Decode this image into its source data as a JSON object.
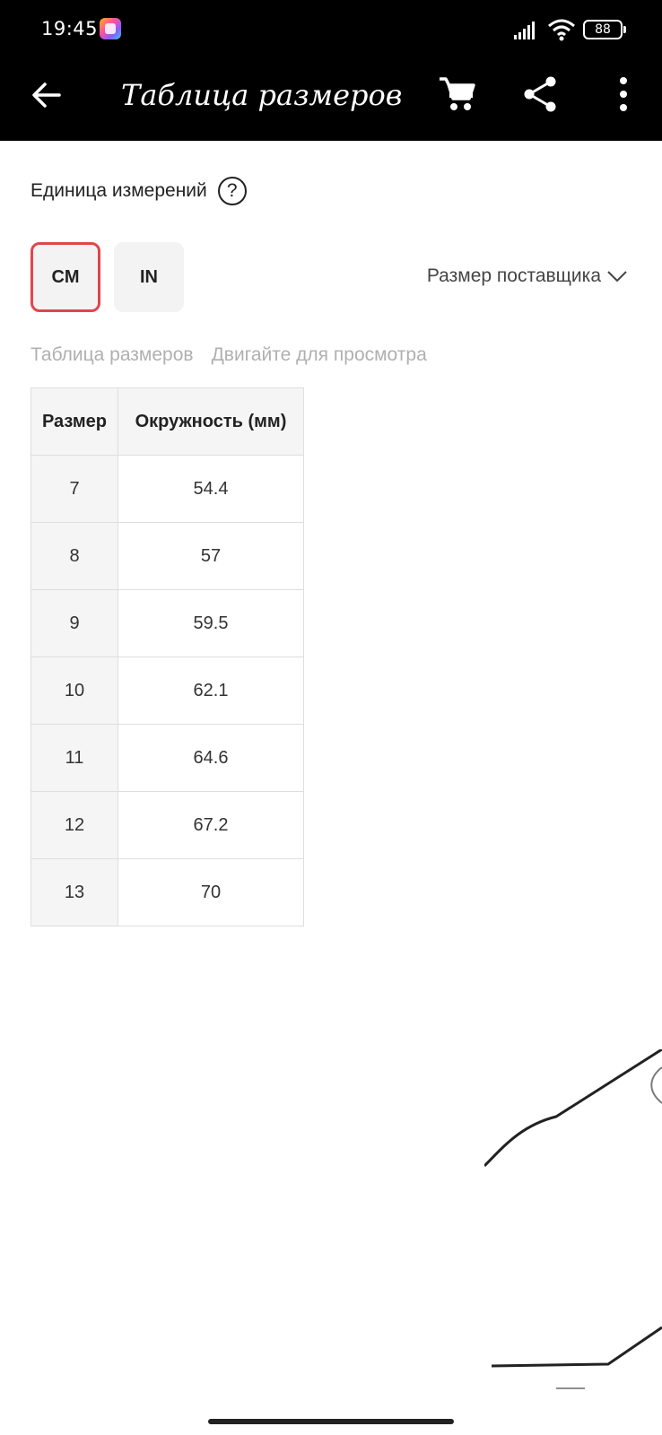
{
  "status_bar": {
    "time": "19:45",
    "battery": "88",
    "icons": [
      "app-badge-icon",
      "signal-icon",
      "wifi-icon",
      "battery-icon"
    ]
  },
  "app_bar": {
    "title": "Таблица размеров",
    "icons": [
      "back-arrow-icon",
      "cart-icon",
      "share-icon",
      "more-vert-icon"
    ]
  },
  "unit": {
    "label": "Единица измерений",
    "help_symbol": "?",
    "options": [
      "CM",
      "IN"
    ],
    "selected": "CM",
    "accent_color": "#e0464c"
  },
  "supplier": {
    "label": "Размер поставщика"
  },
  "hints": {
    "table_label": "Таблица размеров",
    "scroll_hint": "Двигайте для просмотра"
  },
  "table": {
    "headers": [
      "Размер",
      "Окружность (мм)"
    ],
    "rows": [
      [
        "7",
        "54.4"
      ],
      [
        "8",
        "57"
      ],
      [
        "9",
        "59.5"
      ],
      [
        "10",
        "62.1"
      ],
      [
        "11",
        "64.6"
      ],
      [
        "12",
        "67.2"
      ],
      [
        "13",
        "70"
      ]
    ]
  }
}
